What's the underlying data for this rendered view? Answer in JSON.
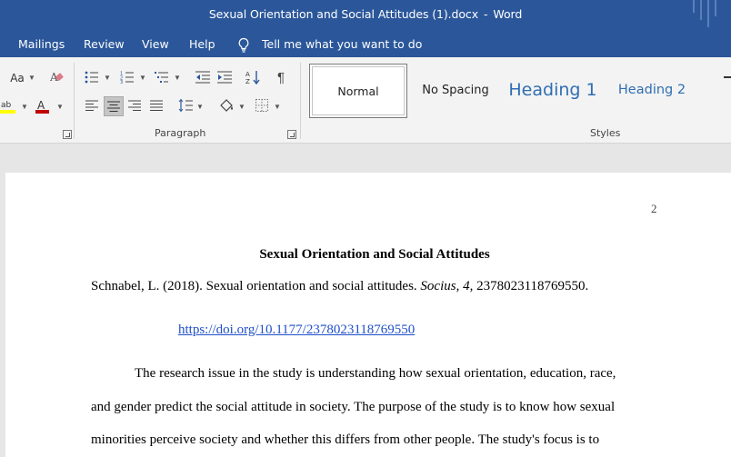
{
  "window": {
    "document_name": "Sexual Orientation and Social Attitudes (1).docx",
    "separator": "-",
    "app_name": "Word"
  },
  "ribbon_tabs": [
    "Mailings",
    "Review",
    "View",
    "Help"
  ],
  "tell_me": {
    "text": "Tell me what you want to do",
    "icon": "lightbulb-icon"
  },
  "ribbon": {
    "font_group": {
      "change_case_label": "Aa",
      "font_color": "#c00000",
      "highlight_color": "#ffff00"
    },
    "paragraph_group": {
      "label": "Paragraph"
    },
    "styles_group": {
      "label": "Styles",
      "items": [
        "Normal",
        "No Spacing",
        "Heading 1",
        "Heading 2"
      ],
      "selected": "Normal"
    }
  },
  "document": {
    "page_number": "2",
    "title": "Sexual Orientation and Social Attitudes",
    "citation": {
      "authors_year": "Schnabel, L. (2018). Sexual orientation and social attitudes.",
      "journal": "Socius",
      "volume": "4",
      "article": ", 2378023118769550."
    },
    "doi_link": "https://doi.org/10.1177/2378023118769550",
    "paragraph_lines": [
      "The research issue in the study is understanding how sexual orientation, education, race,",
      "and gender predict the social attitude in society.  The purpose of the study is to know how sexual",
      "minorities perceive society and whether this differs from other people. The study's focus is to"
    ]
  },
  "colors": {
    "title_bar": "#2b579a",
    "heading_style": "#2f6eb2",
    "link": "#1f4fc7"
  }
}
